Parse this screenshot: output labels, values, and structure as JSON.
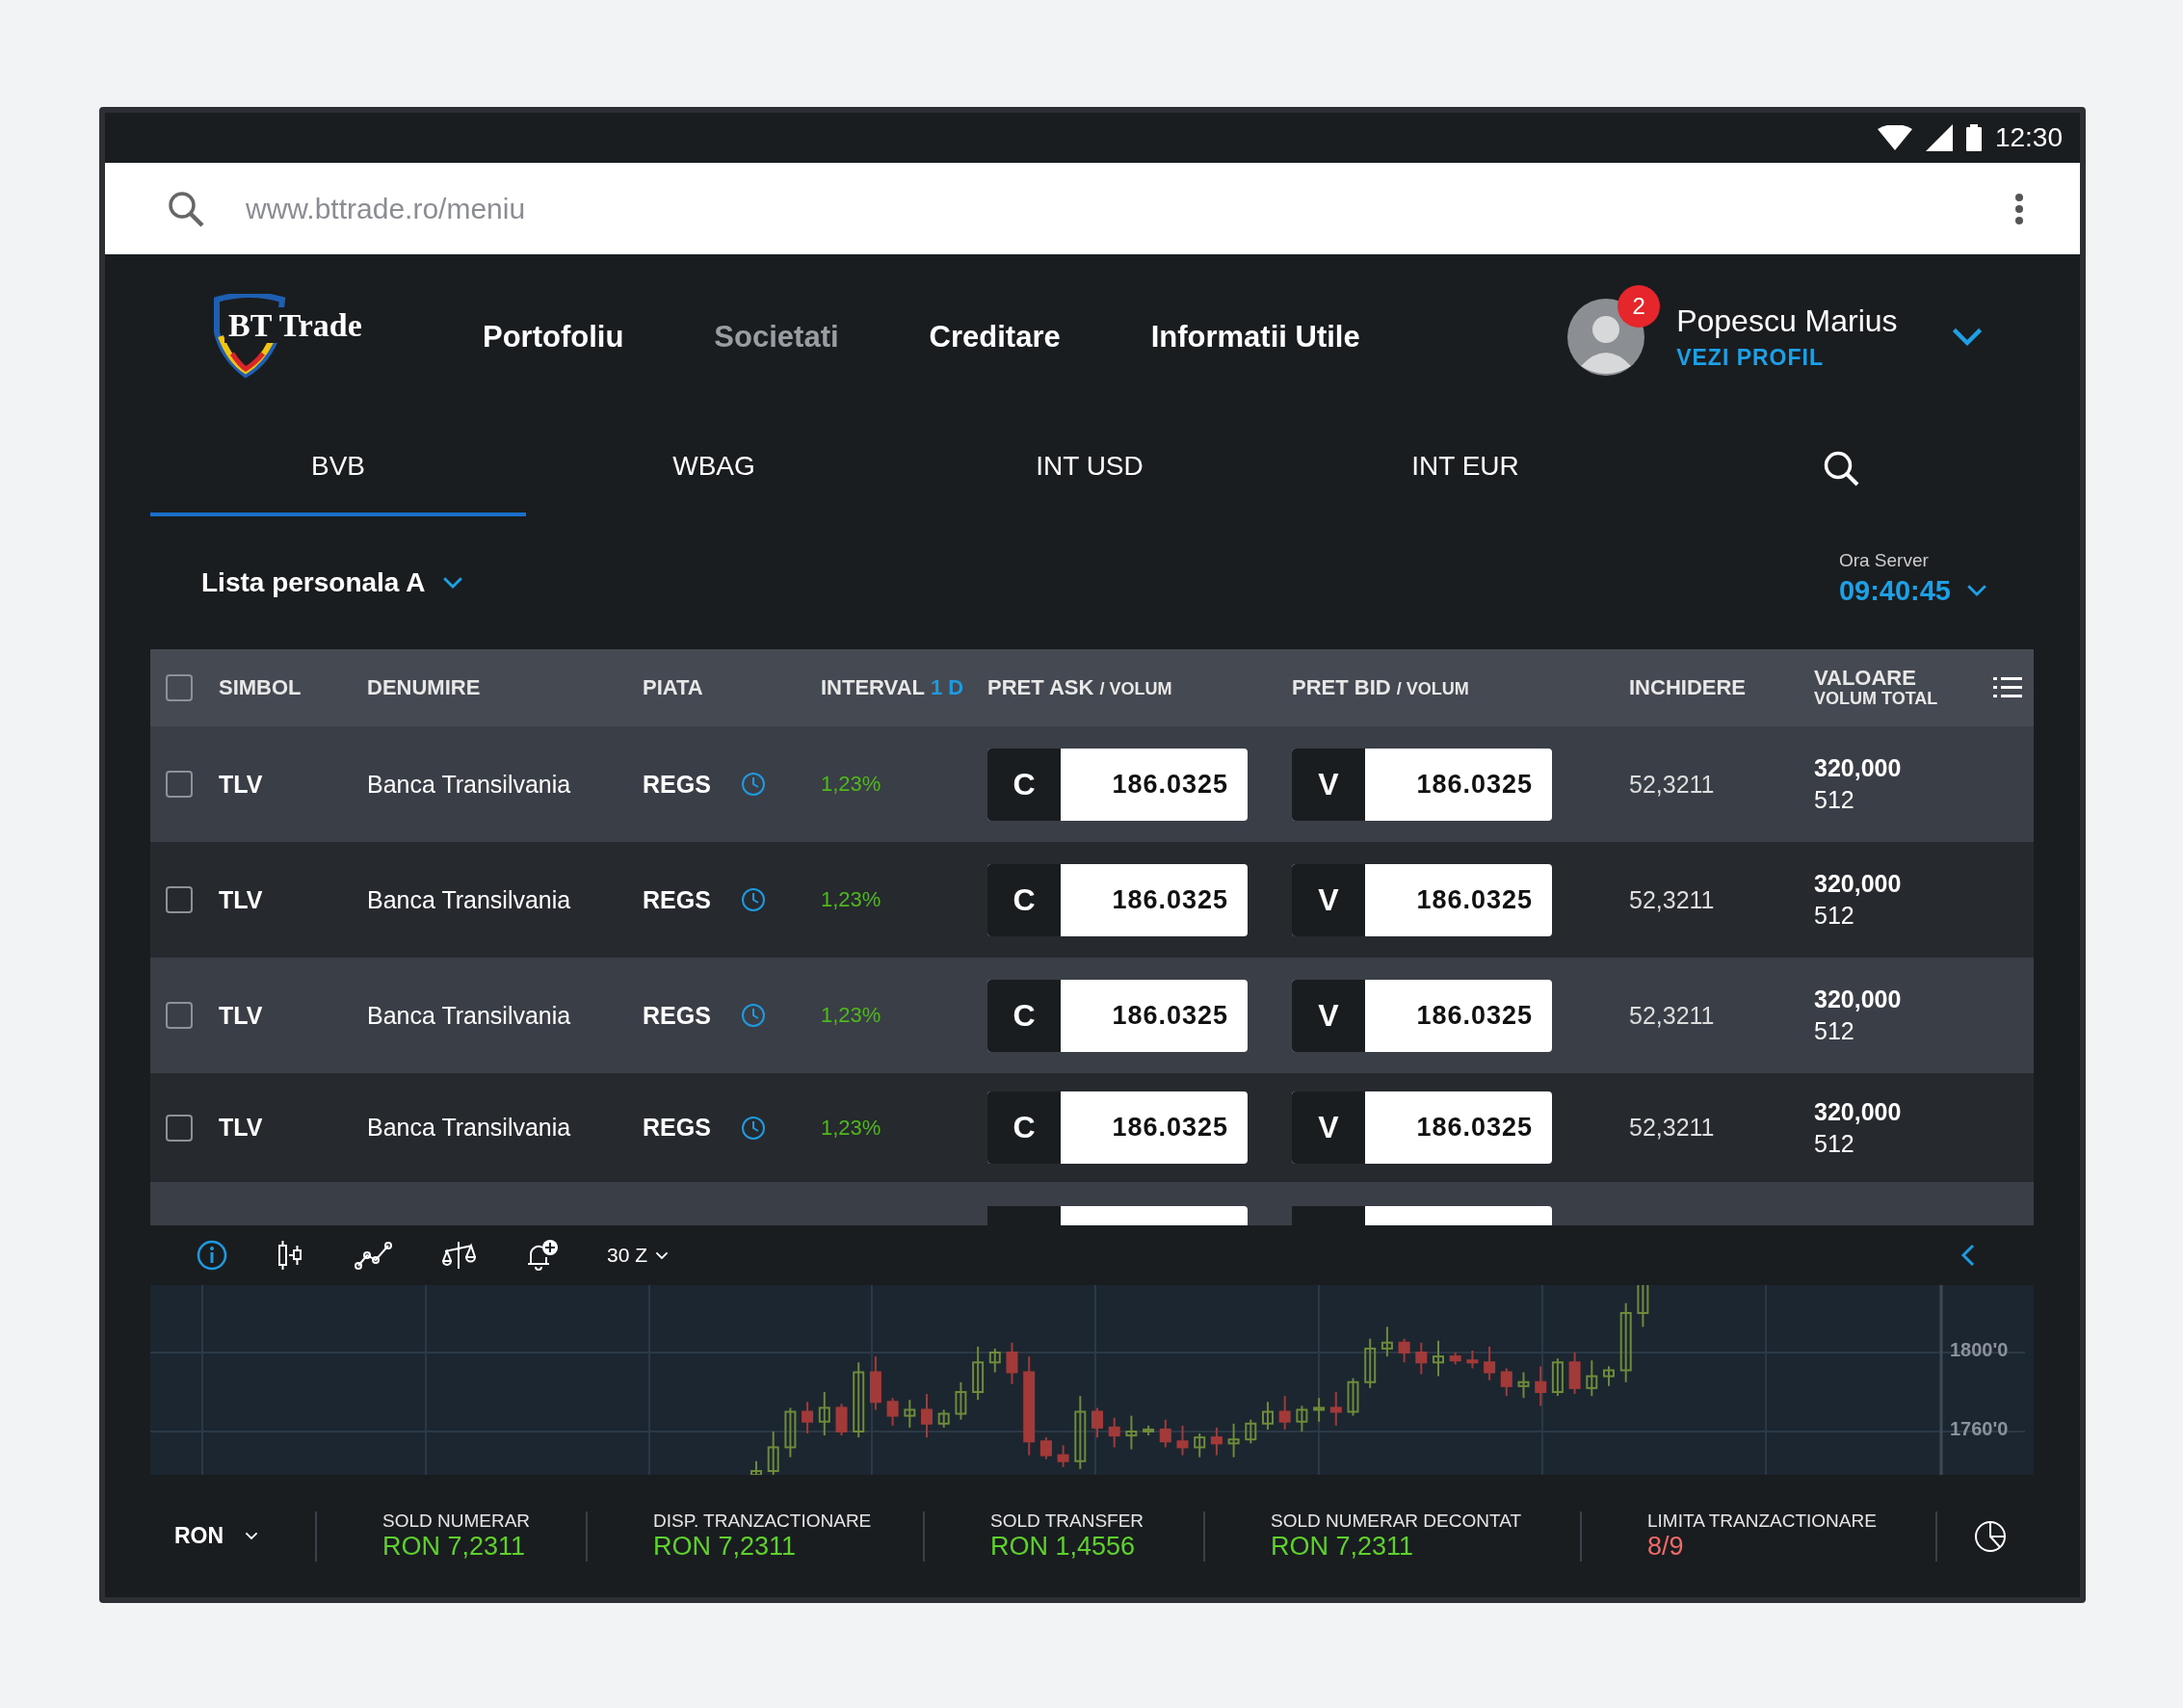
{
  "status_bar": {
    "time": "12:30"
  },
  "browser": {
    "url": "www.bttrade.ro/meniu"
  },
  "header": {
    "logo": "BT Trade",
    "nav": [
      {
        "label": "Portofoliu",
        "disabled": false
      },
      {
        "label": "Societati",
        "disabled": true
      },
      {
        "label": "Creditare",
        "disabled": false
      },
      {
        "label": "Informatii Utile",
        "disabled": false
      }
    ],
    "user": {
      "name": "Popescu Marius",
      "link": "VEZI PROFIL",
      "notifications": "2"
    }
  },
  "market_tabs": [
    {
      "label": "BVB",
      "selected": true
    },
    {
      "label": "WBAG",
      "selected": false
    },
    {
      "label": "INT USD",
      "selected": false
    },
    {
      "label": "INT EUR",
      "selected": false
    }
  ],
  "watchlist": {
    "name": "Lista personala A"
  },
  "server_time": {
    "label": "Ora Server",
    "value": "09:40:45"
  },
  "table": {
    "select_all": {
      "checked": false
    },
    "columns": [
      {
        "label": "SIMBOL",
        "kind": "plain"
      },
      {
        "label": "DENUMIRE",
        "kind": "plain"
      },
      {
        "label": "PIATA",
        "kind": "plain"
      },
      {
        "label": "INTERVAL",
        "suffix": "1 D",
        "kind": "accent"
      },
      {
        "label": "PRET ASK",
        "suffix": "/ VOLUM",
        "kind": "small"
      },
      {
        "label": "PRET BID",
        "suffix": "/ VOLUM",
        "kind": "small"
      },
      {
        "label": "INCHIDERE",
        "kind": "plain"
      },
      {
        "label": "VALOARE",
        "suffix": "VOLUM TOTAL",
        "kind": "stacked"
      }
    ],
    "rows": [
      {
        "checked": false,
        "symbol": "TLV",
        "name": "Banca Transilvania",
        "market": "REGS",
        "change": "1,23%",
        "ask_side": "C",
        "ask": "186.0325",
        "bid_side": "V",
        "bid": "186.0325",
        "close": "52,3211",
        "value": "320,000",
        "volume": "512"
      },
      {
        "checked": false,
        "symbol": "TLV",
        "name": "Banca Transilvania",
        "market": "REGS",
        "change": "1,23%",
        "ask_side": "C",
        "ask": "186.0325",
        "bid_side": "V",
        "bid": "186.0325",
        "close": "52,3211",
        "value": "320,000",
        "volume": "512"
      },
      {
        "checked": false,
        "symbol": "TLV",
        "name": "Banca Transilvania",
        "market": "REGS",
        "change": "1,23%",
        "ask_side": "C",
        "ask": "186.0325",
        "bid_side": "V",
        "bid": "186.0325",
        "close": "52,3211",
        "value": "320,000",
        "volume": "512"
      },
      {
        "checked": false,
        "symbol": "TLV",
        "name": "Banca Transilvania",
        "market": "REGS",
        "change": "1,23%",
        "ask_side": "C",
        "ask": "186.0325",
        "bid_side": "V",
        "bid": "186.0325",
        "close": "52,3211",
        "value": "320,000",
        "volume": "512"
      }
    ]
  },
  "chart_toolbar": {
    "period": "30 Z"
  },
  "chart": {
    "y_labels": [
      "1800'0",
      "1760'0"
    ]
  },
  "balances": {
    "currency": "RON",
    "items": [
      {
        "label": "SOLD NUMERAR",
        "value": "RON 7,2311",
        "kind": "positive"
      },
      {
        "label": "DISP. TRANZACTIONARE",
        "value": "RON 7,2311",
        "kind": "positive"
      },
      {
        "label": "SOLD TRANSFER",
        "value": "RON 1,4556",
        "kind": "positive"
      },
      {
        "label": "SOLD NUMERAR DECONTAT",
        "value": "RON 7,2311",
        "kind": "positive"
      },
      {
        "label": "LIMITA TRANZACTIONARE",
        "value": "8/9",
        "kind": "negative"
      }
    ]
  }
}
